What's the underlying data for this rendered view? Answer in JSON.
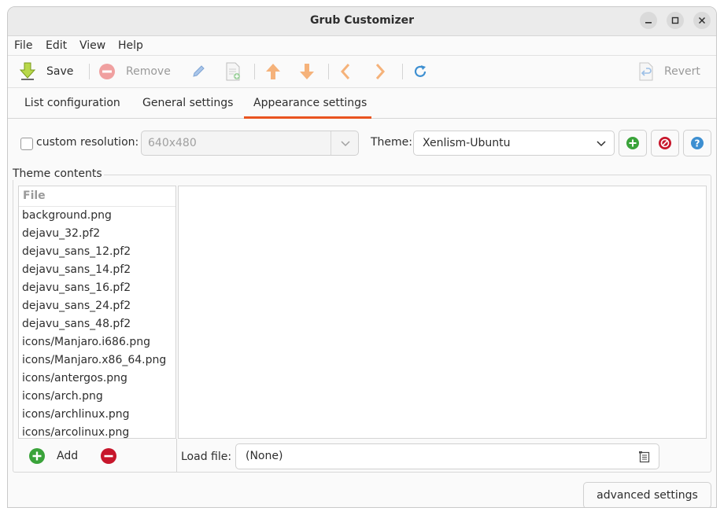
{
  "window": {
    "title": "Grub Customizer"
  },
  "menu": {
    "items": [
      "File",
      "Edit",
      "View",
      "Help"
    ]
  },
  "toolbar": {
    "save_label": "Save",
    "remove_label": "Remove",
    "revert_label": "Revert"
  },
  "tabs": {
    "items": [
      "List configuration",
      "General settings",
      "Appearance settings"
    ],
    "active": "Appearance settings"
  },
  "appearance": {
    "custom_resolution_label": "custom resolution:",
    "custom_resolution_checked": false,
    "resolution_value": "640x480",
    "theme_label": "Theme:",
    "theme_value": "Xenlism-Ubuntu",
    "theme_contents_label": "Theme contents",
    "file_column_header": "File",
    "files": [
      "background.png",
      "dejavu_32.pf2",
      "dejavu_sans_12.pf2",
      "dejavu_sans_14.pf2",
      "dejavu_sans_16.pf2",
      "dejavu_sans_24.pf2",
      "dejavu_sans_48.pf2",
      "icons/Manjaro.i686.png",
      "icons/Manjaro.x86_64.png",
      "icons/antergos.png",
      "icons/arch.png",
      "icons/archlinux.png",
      "icons/arcolinux.png"
    ],
    "add_label": "Add",
    "load_file_label": "Load file:",
    "load_file_value": "(None)",
    "advanced_settings_label": "advanced settings"
  },
  "colors": {
    "accent": "#e95420",
    "add_green": "#3aa33a",
    "remove_red": "#c7162b",
    "info_blue": "#3d8fd1"
  }
}
